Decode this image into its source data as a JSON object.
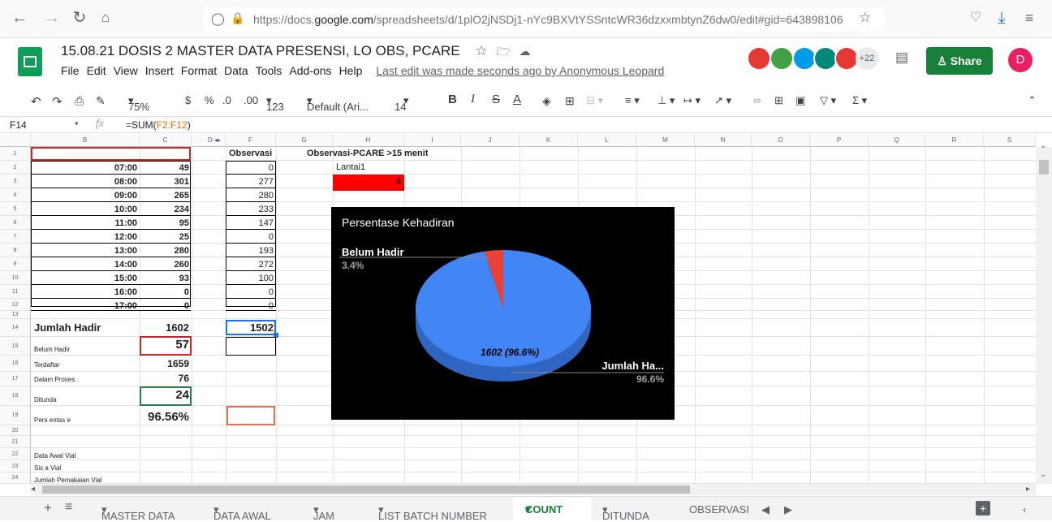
{
  "browser": {
    "url_prefix": "https://docs.",
    "url_domain": "google.com",
    "url_rest": "/spreadsheets/d/1plO2jNSDj1-nYc9BXVtYSSntcWR36dzxxmbtynZ6dw0/edit#gid=643898106"
  },
  "doc": {
    "title": "15.08.21 DOSIS 2 MASTER DATA PRESENSI, LO OBS, PCARE",
    "menus": [
      "File",
      "Edit",
      "View",
      "Insert",
      "Format",
      "Data",
      "Tools",
      "Add-ons",
      "Help"
    ],
    "last_edit": "Last edit was made seconds ago by Anonymous Leopard",
    "avatar_count": "+22",
    "share_label": "Share",
    "user_initial": "D"
  },
  "toolbar": {
    "zoom": "75%",
    "currency": "$",
    "percent": "%",
    "dec_less": ".0",
    "dec_more": ".00",
    "more_formats": "123",
    "font": "Default (Ari...",
    "font_size": "14",
    "bold": "B",
    "italic": "I",
    "strike": "S",
    "textcolor": "A"
  },
  "formula": {
    "cell_ref": "F14",
    "fx": "fx",
    "prefix": "=SUM(",
    "range": "F2:F12",
    "suffix": ")"
  },
  "columns": [
    "B",
    "C",
    "D",
    "F",
    "G",
    "H",
    "I",
    "J",
    "K",
    "L",
    "M",
    "N",
    "O",
    "P",
    "Q",
    "R",
    "S"
  ],
  "rows": [
    "1",
    "2",
    "3",
    "4",
    "5",
    "6",
    "7",
    "8",
    "9",
    "10",
    "11",
    "12",
    "13",
    "14",
    "15",
    "16",
    "17",
    "18",
    "19",
    "20",
    "21",
    "22",
    "23",
    "24"
  ],
  "sheet": {
    "obs_header": "Observasi",
    "pcare_header": "Observasi-PCARE >15 menit",
    "lantai": "Lantai1",
    "lantai_value": "4",
    "times": [
      "07:00",
      "08:00",
      "09:00",
      "10:00",
      "11:00",
      "12:00",
      "13:00",
      "14:00",
      "15:00",
      "16:00",
      "17:00"
    ],
    "c_values": [
      "49",
      "301",
      "265",
      "234",
      "95",
      "25",
      "280",
      "260",
      "93",
      "0",
      "0"
    ],
    "f_values": [
      "0",
      "277",
      "280",
      "233",
      "147",
      "0",
      "193",
      "272",
      "100",
      "0",
      "0"
    ],
    "jumlah_hadir_label": "Jumlah Hadir",
    "jumlah_hadir_value": "1602",
    "obs_total": "1502",
    "belum_hadir_label": "Belum Hadir",
    "belum_hadir_value": "57",
    "terdaftar_label": "Terdaftar",
    "terdaftar_value": "1659",
    "dalam_proses_label": "Dalam Proses",
    "dalam_proses_value": "76",
    "ditunda_label": "Ditunda",
    "ditunda_value": "24",
    "persentase_label": "Pers entas e",
    "persentase_value": "96.56%",
    "data_awal_vial": "Data Awal Vial",
    "sisa_vial": "Sis a Vial",
    "jumlah_pemakaian": "Jumlah Pemakaian Vial"
  },
  "chart_data": {
    "type": "pie",
    "title": "Persentase Kehadiran",
    "labels": [
      "Belum Hadir",
      "Jumlah Ha..."
    ],
    "values": [
      57,
      1602
    ],
    "percent_labels": [
      "3.4%",
      "96.6%"
    ],
    "inner_label": "1602 (96.6%)",
    "colors": [
      "#ea4335",
      "#4285f4"
    ],
    "background": "#000000",
    "style": "3d"
  },
  "tabs": [
    "MASTER DATA",
    "DATA AWAL",
    "JAM",
    "LIST BATCH NUMBER",
    "COUNT",
    "DITUNDA",
    "OBSERVASI"
  ],
  "active_tab": "COUNT",
  "colors": {
    "accent": "#188038",
    "active_tab": "#188038",
    "red_cell": "#ff0000"
  }
}
